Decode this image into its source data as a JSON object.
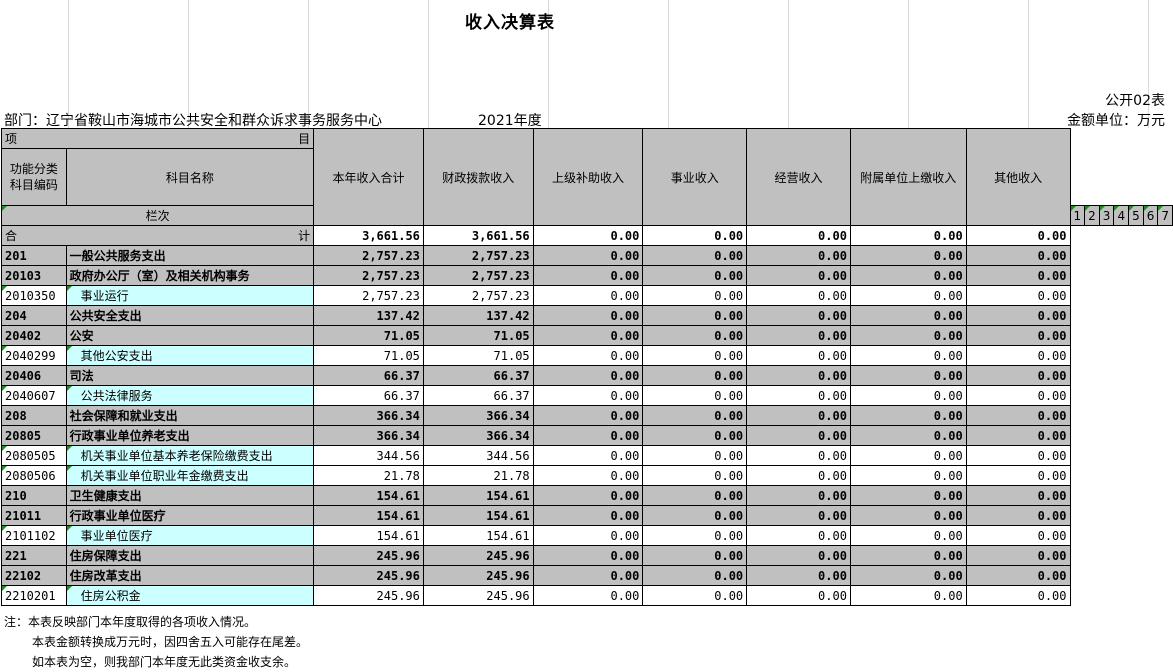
{
  "title": "收入决算表",
  "form_no": "公开02表",
  "department": "部门：辽宁省鞍山市海城市公共安全和群众诉求事务服务中心",
  "year": "2021年度",
  "unit": "金额单位：万元",
  "header": {
    "xiang": "项",
    "mu": "目",
    "code_label": "功能分类\n科目编码",
    "name_label": "科目名称",
    "lanci": "栏次",
    "columns": [
      "本年收入合计",
      "财政拨款收入",
      "上级补助收入",
      "事业收入",
      "经营收入",
      "附属单位上缴收入",
      "其他收入"
    ],
    "col_numbers": [
      "1",
      "2",
      "3",
      "4",
      "5",
      "6",
      "7"
    ]
  },
  "total_row": {
    "label_left": "合",
    "label_right": "计",
    "values": [
      "3,661.56",
      "3,661.56",
      "0.00",
      "0.00",
      "0.00",
      "0.00",
      "0.00"
    ]
  },
  "rows": [
    {
      "code": "201",
      "name": "一般公共服务支出",
      "level": "class",
      "values": [
        "2,757.23",
        "2,757.23",
        "0.00",
        "0.00",
        "0.00",
        "0.00",
        "0.00"
      ]
    },
    {
      "code": "20103",
      "name": "政府办公厅（室）及相关机构事务",
      "level": "class",
      "values": [
        "2,757.23",
        "2,757.23",
        "0.00",
        "0.00",
        "0.00",
        "0.00",
        "0.00"
      ]
    },
    {
      "code": "2010350",
      "name": "事业运行",
      "level": "item",
      "values": [
        "2,757.23",
        "2,757.23",
        "0.00",
        "0.00",
        "0.00",
        "0.00",
        "0.00"
      ]
    },
    {
      "code": "204",
      "name": "公共安全支出",
      "level": "class",
      "values": [
        "137.42",
        "137.42",
        "0.00",
        "0.00",
        "0.00",
        "0.00",
        "0.00"
      ]
    },
    {
      "code": "20402",
      "name": "公安",
      "level": "class",
      "values": [
        "71.05",
        "71.05",
        "0.00",
        "0.00",
        "0.00",
        "0.00",
        "0.00"
      ]
    },
    {
      "code": "2040299",
      "name": "其他公安支出",
      "level": "item",
      "values": [
        "71.05",
        "71.05",
        "0.00",
        "0.00",
        "0.00",
        "0.00",
        "0.00"
      ]
    },
    {
      "code": "20406",
      "name": "司法",
      "level": "class",
      "values": [
        "66.37",
        "66.37",
        "0.00",
        "0.00",
        "0.00",
        "0.00",
        "0.00"
      ]
    },
    {
      "code": "2040607",
      "name": "公共法律服务",
      "level": "item",
      "values": [
        "66.37",
        "66.37",
        "0.00",
        "0.00",
        "0.00",
        "0.00",
        "0.00"
      ]
    },
    {
      "code": "208",
      "name": "社会保障和就业支出",
      "level": "class",
      "values": [
        "366.34",
        "366.34",
        "0.00",
        "0.00",
        "0.00",
        "0.00",
        "0.00"
      ]
    },
    {
      "code": "20805",
      "name": "行政事业单位养老支出",
      "level": "class",
      "values": [
        "366.34",
        "366.34",
        "0.00",
        "0.00",
        "0.00",
        "0.00",
        "0.00"
      ]
    },
    {
      "code": "2080505",
      "name": "机关事业单位基本养老保险缴费支出",
      "level": "item",
      "values": [
        "344.56",
        "344.56",
        "0.00",
        "0.00",
        "0.00",
        "0.00",
        "0.00"
      ]
    },
    {
      "code": "2080506",
      "name": "机关事业单位职业年金缴费支出",
      "level": "item",
      "values": [
        "21.78",
        "21.78",
        "0.00",
        "0.00",
        "0.00",
        "0.00",
        "0.00"
      ]
    },
    {
      "code": "210",
      "name": "卫生健康支出",
      "level": "class",
      "values": [
        "154.61",
        "154.61",
        "0.00",
        "0.00",
        "0.00",
        "0.00",
        "0.00"
      ]
    },
    {
      "code": "21011",
      "name": "行政事业单位医疗",
      "level": "class",
      "values": [
        "154.61",
        "154.61",
        "0.00",
        "0.00",
        "0.00",
        "0.00",
        "0.00"
      ]
    },
    {
      "code": "2101102",
      "name": "事业单位医疗",
      "level": "item",
      "values": [
        "154.61",
        "154.61",
        "0.00",
        "0.00",
        "0.00",
        "0.00",
        "0.00"
      ]
    },
    {
      "code": "221",
      "name": "住房保障支出",
      "level": "class",
      "values": [
        "245.96",
        "245.96",
        "0.00",
        "0.00",
        "0.00",
        "0.00",
        "0.00"
      ]
    },
    {
      "code": "22102",
      "name": "住房改革支出",
      "level": "class",
      "values": [
        "245.96",
        "245.96",
        "0.00",
        "0.00",
        "0.00",
        "0.00",
        "0.00"
      ]
    },
    {
      "code": "2210201",
      "name": "住房公积金",
      "level": "item",
      "values": [
        "245.96",
        "245.96",
        "0.00",
        "0.00",
        "0.00",
        "0.00",
        "0.00"
      ]
    }
  ],
  "notes": [
    "注：本表反映部门本年度取得的各项收入情况。",
    "本表金额转换成万元时，因四舍五入可能存在尾差。",
    "如本表为空，则我部门本年度无此类资金收支余。"
  ]
}
